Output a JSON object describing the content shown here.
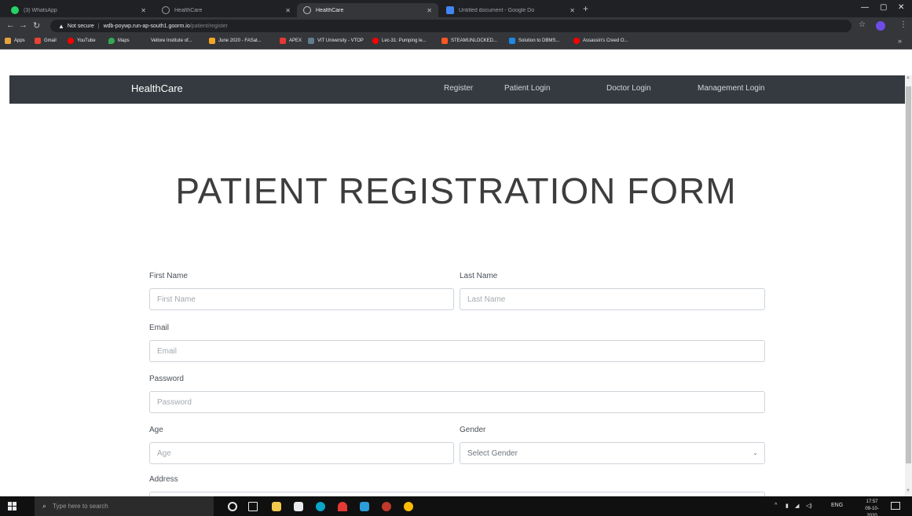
{
  "browser": {
    "tabs": [
      {
        "title": "(3) WhatsApp",
        "color": "#25d366",
        "active": false
      },
      {
        "title": "HealthCare",
        "color": "#9aa0a6",
        "active": false
      },
      {
        "title": "HealthCare",
        "color": "#9aa0a6",
        "active": true
      },
      {
        "title": "Untitled document - Google Do",
        "color": "#4285f4",
        "active": false
      }
    ],
    "security_label": "Not secure",
    "url_host": "wdb-poywp.run-ap-south1.goorm.io",
    "url_path": "/patient/register",
    "bookmarks": [
      {
        "label": "Apps",
        "color": "#e8a33d"
      },
      {
        "label": "Gmail",
        "color": "#ea4335"
      },
      {
        "label": "YouTube",
        "color": "#ff0000"
      },
      {
        "label": "Maps",
        "color": "#34a853"
      },
      {
        "label": "Vellore Institute of...",
        "color": "#35363a"
      },
      {
        "label": "June 2020 - FASat...",
        "color": "#f5a623"
      },
      {
        "label": "APEX",
        "color": "#e53935"
      },
      {
        "label": "VIT University - VTOP",
        "color": "#607d8b"
      },
      {
        "label": "Lec-31: Pumping le...",
        "color": "#ff0000"
      },
      {
        "label": "STEAMUNLOCKED...",
        "color": "#ff5722"
      },
      {
        "label": "Solution to DBMS...",
        "color": "#1e88e5"
      },
      {
        "label": "Assassin's Creed O...",
        "color": "#ff0000"
      }
    ]
  },
  "navbar": {
    "brand": "HealthCare",
    "links": {
      "register": "Register",
      "patient_login": "Patient Login",
      "doctor_login": "Doctor Login",
      "management_login": "Management Login"
    }
  },
  "form": {
    "title": "PATIENT REGISTRATION FORM",
    "first_name": {
      "label": "First Name",
      "placeholder": "First Name",
      "value": ""
    },
    "last_name": {
      "label": "Last Name",
      "placeholder": "Last Name",
      "value": ""
    },
    "email": {
      "label": "Email",
      "placeholder": "Email",
      "value": ""
    },
    "password": {
      "label": "Password",
      "placeholder": "Password",
      "value": ""
    },
    "age": {
      "label": "Age",
      "placeholder": "Age",
      "value": ""
    },
    "gender": {
      "label": "Gender",
      "selected": "Select Gender"
    },
    "address": {
      "label": "Address"
    }
  },
  "taskbar": {
    "search_placeholder": "Type here to search",
    "language": "ENG",
    "time": "17:57",
    "date": "09-10-2020"
  }
}
